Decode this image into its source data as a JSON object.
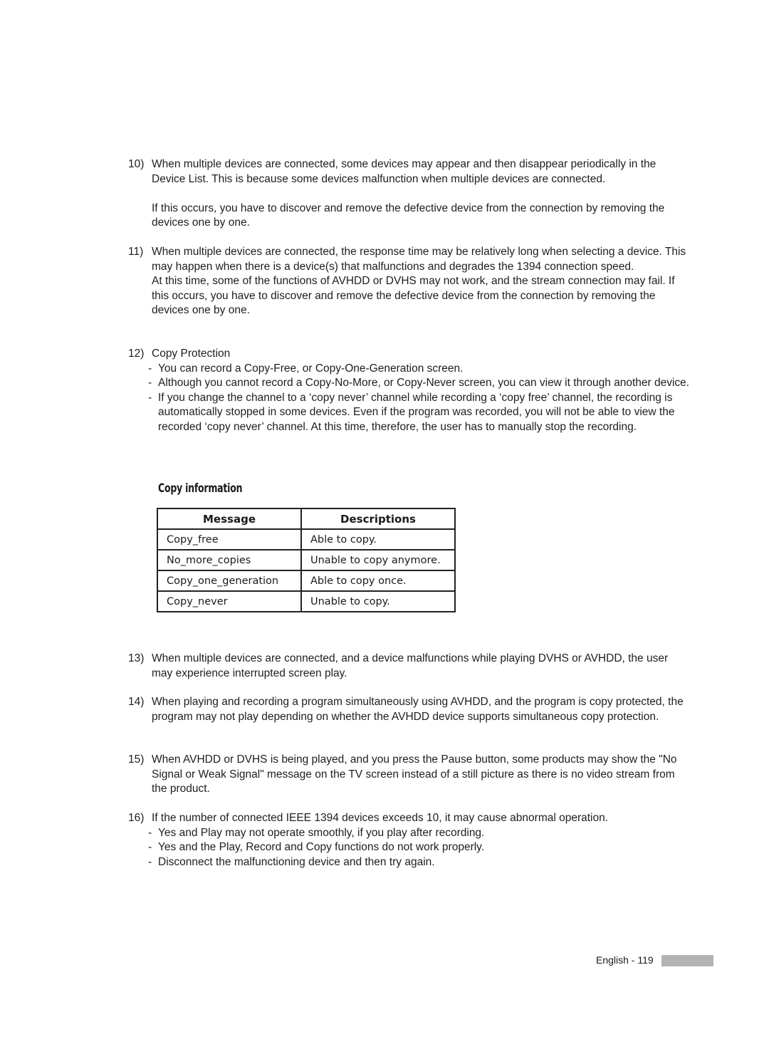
{
  "items": [
    {
      "num": "10)",
      "paras": [
        "When multiple devices are connected, some devices may appear and then disappear periodically in the Device List. This is because some devices malfunction when multiple devices are connected.",
        "If this occurs, you have to discover and remove the defective device from the connection by removing the devices one by one."
      ]
    },
    {
      "num": "11)",
      "paras": [
        "When multiple devices are connected, the response time may be relatively long when selecting a device. This may happen when there is a device(s) that malfunctions and degrades the 1394 connection speed.",
        "At this time, some of the functions of AVHDD or DVHS may not work, and the stream connection may fail. If this occurs, you have to discover and remove the defective device from the connection by removing the devices one by one."
      ]
    },
    {
      "num": "12)",
      "title": "Copy Protection",
      "bullets": [
        "You can record a Copy-Free, or Copy-One-Generation screen.",
        "Although you cannot record a Copy-No-More, or Copy-Never screen, you can view it through another device.",
        "If you change the channel to a ‘copy never’ channel while recording a ‘copy free’ channel, the recording is automatically stopped in some devices. Even if the program was recorded, you will not be able to view the recorded ‘copy never’ channel. At this time, therefore, the user has to manually stop the recording."
      ]
    },
    {
      "num": "13)",
      "paras": [
        "When multiple devices are connected, and a device malfunctions while playing DVHS or AVHDD, the user may experience interrupted screen play."
      ]
    },
    {
      "num": "14)",
      "paras": [
        "When playing and recording a program simultaneously using AVHDD, and the program is copy protected, the program may not play depending on whether the AVHDD device supports simultaneous copy protection."
      ]
    },
    {
      "num": "15)",
      "paras": [
        "When AVHDD or DVHS is being played, and you press the Pause button, some products may show the \"No Signal or Weak Signal\" message on the TV screen instead of a still picture as there is no video stream from the product."
      ]
    },
    {
      "num": "16)",
      "title": "If the number of connected IEEE 1394 devices exceeds 10, it may cause abnormal operation.",
      "bullets": [
        "Yes and Play may not operate smoothly, if you play after recording.",
        "Yes and the Play, Record and Copy functions do not work properly.",
        "Disconnect the malfunctioning device and then try again."
      ]
    }
  ],
  "copy_info": {
    "title": "Copy information",
    "headers": [
      "Message",
      "Descriptions"
    ],
    "rows": [
      [
        "Copy_free",
        "Able to copy."
      ],
      [
        "No_more_copies",
        "Unable to copy anymore."
      ],
      [
        "Copy_one_generation",
        "Able to copy once."
      ],
      [
        "Copy_never",
        "Unable to copy."
      ]
    ]
  },
  "footer": {
    "page_label": "English - 119"
  }
}
